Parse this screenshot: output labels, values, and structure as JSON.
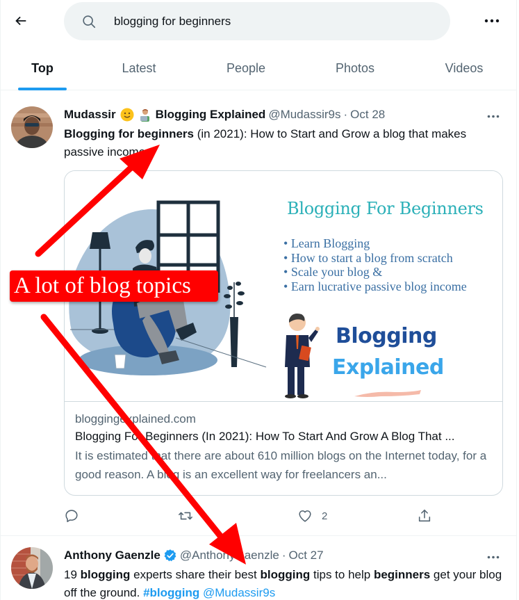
{
  "search": {
    "query": "blogging for beginners",
    "back_icon": "arrow-left-icon",
    "search_icon": "search-icon",
    "more_icon": "more-horizontal-icon"
  },
  "tabs": [
    {
      "label": "Top",
      "active": true
    },
    {
      "label": "Latest",
      "active": false
    },
    {
      "label": "People",
      "active": false
    },
    {
      "label": "Photos",
      "active": false
    },
    {
      "label": "Videos",
      "active": false
    }
  ],
  "tweets": [
    {
      "name_part1": "Mudassir",
      "name_emoji1": "slightly-smiling-face",
      "name_emoji2": "technologist",
      "name_part2": "Blogging Explained",
      "handle": "@Mudassir9s",
      "separator": "·",
      "date": "Oct 28",
      "text_bold": "Blogging for beginners",
      "text_rest": " (in 2021): How to Start and Grow a blog that makes passive income",
      "card": {
        "image": {
          "title": "Blogging For Beginners",
          "bullets": [
            "Learn Blogging",
            "How to start a blog from scratch",
            "Scale your blog &",
            "Earn lucrative passive blog income"
          ],
          "brand_line1": "Blogging",
          "brand_line2": "Explained"
        },
        "domain": "bloggingexplained.com",
        "title": "Blogging For Beginners (In 2021): How To Start And Grow A Blog That ...",
        "description": "It is estimated that there are about 610 million blogs on the Internet today, for a good reason. A blog is an excellent way for freelancers an..."
      },
      "actions": {
        "reply": {
          "icon": "reply-icon",
          "count": ""
        },
        "retweet": {
          "icon": "retweet-icon",
          "count": ""
        },
        "like": {
          "icon": "heart-icon",
          "count": "2"
        },
        "share": {
          "icon": "share-icon",
          "count": ""
        }
      }
    },
    {
      "name": "Anthony Gaenzle",
      "verified": true,
      "handle": "@AnthonyGaenzle",
      "separator": "·",
      "date": "Oct 27",
      "text_segments": [
        {
          "t": "19 ",
          "style": "normal"
        },
        {
          "t": "blogging",
          "style": "bold"
        },
        {
          "t": " experts share their best ",
          "style": "normal"
        },
        {
          "t": "blogging",
          "style": "bold"
        },
        {
          "t": " tips to help ",
          "style": "normal"
        },
        {
          "t": "beginners",
          "style": "bold"
        },
        {
          "t": " get your blog off the ground. ",
          "style": "normal"
        },
        {
          "t": "#blogging",
          "style": "hashtag"
        },
        {
          "t": " ",
          "style": "normal"
        },
        {
          "t": "@Mudassir9s",
          "style": "mention"
        }
      ]
    }
  ],
  "annotation": {
    "label": "A lot of blog topics",
    "color": "#ff0000"
  },
  "colors": {
    "accent": "#1d9bf0",
    "text_primary": "#0f1419",
    "text_secondary": "#536471",
    "border": "#cfd9de",
    "search_bg": "#eff3f4"
  }
}
